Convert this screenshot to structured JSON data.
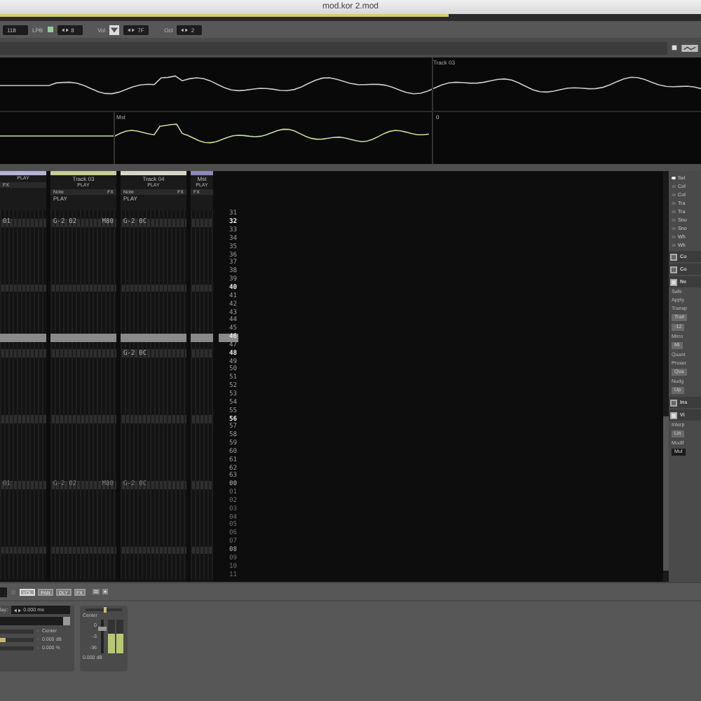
{
  "window": {
    "title": "mod.kor 2.mod"
  },
  "song_position": {
    "level": 0.64
  },
  "toolbar": {
    "tempo": "118",
    "lpb_label": "LPB",
    "lpb_on": true,
    "lpb_value": "8",
    "vol_label": "Vol",
    "vol_value": "7F",
    "oct_label": "Oct",
    "oct_value": "2"
  },
  "scopes": {
    "track_label": "Track 03",
    "master_label": "Mst",
    "zero_label": "0"
  },
  "tracks": [
    {
      "color": "#b4b4d8",
      "play": "PLAY",
      "fx": "FX"
    },
    {
      "color": "#c6cb9a",
      "name": "Track 03",
      "play": "PLAY",
      "note": "Note",
      "fx": "FX",
      "sub": "PLAY"
    },
    {
      "color": "#d6d6c6",
      "name": "Track 04",
      "play": "PLAY",
      "note": "Note",
      "fx": "FX",
      "sub": "PLAY"
    },
    {
      "color": "#8a8ab8",
      "name": "Mst",
      "play": "PLAY",
      "fx": "FX"
    }
  ],
  "rows": [
    {
      "number": "31",
      "beat": false,
      "cursor": false,
      "next_pattern": false
    },
    {
      "number": "32",
      "beat": true,
      "cursor": false,
      "next_pattern": false,
      "column_1": "01",
      "track_03_note": "G-2 02",
      "track_03_fx": "M80",
      "track_04_note": "G-2 0C"
    },
    {
      "number": "33",
      "beat": false,
      "cursor": false,
      "next_pattern": false
    },
    {
      "number": "34",
      "beat": false,
      "cursor": false,
      "next_pattern": false
    },
    {
      "number": "35",
      "beat": false,
      "cursor": false,
      "next_pattern": false
    },
    {
      "number": "36",
      "beat": false,
      "cursor": false,
      "next_pattern": false
    },
    {
      "number": "37",
      "beat": false,
      "cursor": false,
      "next_pattern": false
    },
    {
      "number": "38",
      "beat": false,
      "cursor": false,
      "next_pattern": false
    },
    {
      "number": "39",
      "beat": false,
      "cursor": false,
      "next_pattern": false
    },
    {
      "number": "40",
      "beat": true,
      "cursor": false,
      "next_pattern": false
    },
    {
      "number": "41",
      "beat": false,
      "cursor": false,
      "next_pattern": false
    },
    {
      "number": "42",
      "beat": false,
      "cursor": false,
      "next_pattern": false
    },
    {
      "number": "43",
      "beat": false,
      "cursor": false,
      "next_pattern": false
    },
    {
      "number": "44",
      "beat": false,
      "cursor": false,
      "next_pattern": false
    },
    {
      "number": "45",
      "beat": false,
      "cursor": false,
      "next_pattern": false
    },
    {
      "number": "46",
      "beat": false,
      "cursor": true,
      "next_pattern": false
    },
    {
      "number": "47",
      "beat": false,
      "cursor": false,
      "next_pattern": false
    },
    {
      "number": "48",
      "beat": true,
      "cursor": false,
      "next_pattern": false,
      "track_04_note": "G-2 0C"
    },
    {
      "number": "49",
      "beat": false,
      "cursor": false,
      "next_pattern": false
    },
    {
      "number": "50",
      "beat": false,
      "cursor": false,
      "next_pattern": false
    },
    {
      "number": "51",
      "beat": false,
      "cursor": false,
      "next_pattern": false
    },
    {
      "number": "52",
      "beat": false,
      "cursor": false,
      "next_pattern": false
    },
    {
      "number": "53",
      "beat": false,
      "cursor": false,
      "next_pattern": false
    },
    {
      "number": "54",
      "beat": false,
      "cursor": false,
      "next_pattern": false
    },
    {
      "number": "55",
      "beat": false,
      "cursor": false,
      "next_pattern": false
    },
    {
      "number": "56",
      "beat": true,
      "cursor": false,
      "next_pattern": false
    },
    {
      "number": "57",
      "beat": false,
      "cursor": false,
      "next_pattern": false
    },
    {
      "number": "58",
      "beat": false,
      "cursor": false,
      "next_pattern": false
    },
    {
      "number": "59",
      "beat": false,
      "cursor": false,
      "next_pattern": false
    },
    {
      "number": "60",
      "beat": false,
      "cursor": false,
      "next_pattern": false
    },
    {
      "number": "61",
      "beat": false,
      "cursor": false,
      "next_pattern": false
    },
    {
      "number": "62",
      "beat": false,
      "cursor": false,
      "next_pattern": false
    },
    {
      "number": "63",
      "beat": false,
      "cursor": false,
      "next_pattern": false
    },
    {
      "number": "00",
      "beat": true,
      "cursor": false,
      "next_pattern": true,
      "column_1": "01",
      "track_03_note": "G-2 02",
      "track_03_fx": "M80",
      "track_04_note": "G-2 0C"
    },
    {
      "number": "01",
      "beat": false,
      "cursor": false,
      "next_pattern": true
    },
    {
      "number": "02",
      "beat": false,
      "cursor": false,
      "next_pattern": true
    },
    {
      "number": "03",
      "beat": false,
      "cursor": false,
      "next_pattern": true
    },
    {
      "number": "04",
      "beat": false,
      "cursor": false,
      "next_pattern": true
    },
    {
      "number": "05",
      "beat": false,
      "cursor": false,
      "next_pattern": true
    },
    {
      "number": "06",
      "beat": false,
      "cursor": false,
      "next_pattern": true
    },
    {
      "number": "07",
      "beat": false,
      "cursor": false,
      "next_pattern": true
    },
    {
      "number": "08",
      "beat": true,
      "cursor": false,
      "next_pattern": true
    },
    {
      "number": "09",
      "beat": false,
      "cursor": false,
      "next_pattern": true
    },
    {
      "number": "10",
      "beat": false,
      "cursor": false,
      "next_pattern": true
    },
    {
      "number": "11",
      "beat": false,
      "cursor": false,
      "next_pattern": true
    }
  ],
  "side_panel": {
    "options": [
      {
        "label": "Sel",
        "selected": true
      },
      {
        "label": "Col",
        "selected": false
      },
      {
        "label": "Col",
        "selected": false
      },
      {
        "label": "Tra",
        "selected": false
      },
      {
        "label": "Tra",
        "selected": false
      },
      {
        "label": "Sno",
        "selected": false
      },
      {
        "label": "Sno",
        "selected": false
      },
      {
        "label": "Wh",
        "selected": false
      },
      {
        "label": "Wh",
        "selected": false
      }
    ],
    "sections": [
      {
        "label": "Co",
        "expanded": false
      },
      {
        "label": "Co",
        "expanded": false
      },
      {
        "label": "Ne",
        "expanded": true,
        "items": [
          {
            "kind": "text",
            "text": "Safe"
          },
          {
            "kind": "text",
            "text": "Apply"
          },
          {
            "kind": "text",
            "text": "Transp"
          },
          {
            "kind": "button",
            "text": "Tran"
          },
          {
            "kind": "button",
            "text": "-12"
          },
          {
            "kind": "text",
            "text": "Mirro"
          },
          {
            "kind": "button",
            "text": "Mi"
          },
          {
            "kind": "text",
            "text": "Quant"
          },
          {
            "kind": "text",
            "text": "Preser"
          },
          {
            "kind": "button",
            "text": "Qua"
          },
          {
            "kind": "text",
            "text": "Nudg"
          },
          {
            "kind": "button",
            "text": "Up"
          }
        ]
      },
      {
        "label": "Ins",
        "expanded": false
      },
      {
        "label": "Vi",
        "expanded": true,
        "items": [
          {
            "kind": "text",
            "text": "Interp"
          },
          {
            "kind": "button",
            "text": "Lin"
          },
          {
            "kind": "text",
            "text": "Modif"
          },
          {
            "kind": "field",
            "text": "Mul"
          }
        ]
      }
    ]
  },
  "lower_toolbar": {
    "tabs": [
      {
        "label": "VOL",
        "selected": true
      },
      {
        "label": "PAN",
        "selected": false
      },
      {
        "label": "DLY",
        "selected": false
      },
      {
        "label": "FX",
        "selected": false
      }
    ]
  },
  "devices": {
    "delay_label": "lay:",
    "delay_value": "0.000 ms",
    "sliders": [
      {
        "label": "Center",
        "level": 0
      },
      {
        "label": "0.000 dB",
        "level": 0.17
      },
      {
        "label": "0.000 %",
        "level": 0
      }
    ],
    "mixer": {
      "pan": {
        "level": 0.5
      },
      "pan_label": "Center",
      "fader": {
        "level": 0.8
      },
      "fader_marks": [
        "0",
        "-3",
        "-36"
      ],
      "meters": [
        {
          "level": 0.6
        },
        {
          "level": 0.6
        }
      ],
      "volume": "0.000 dB"
    }
  }
}
